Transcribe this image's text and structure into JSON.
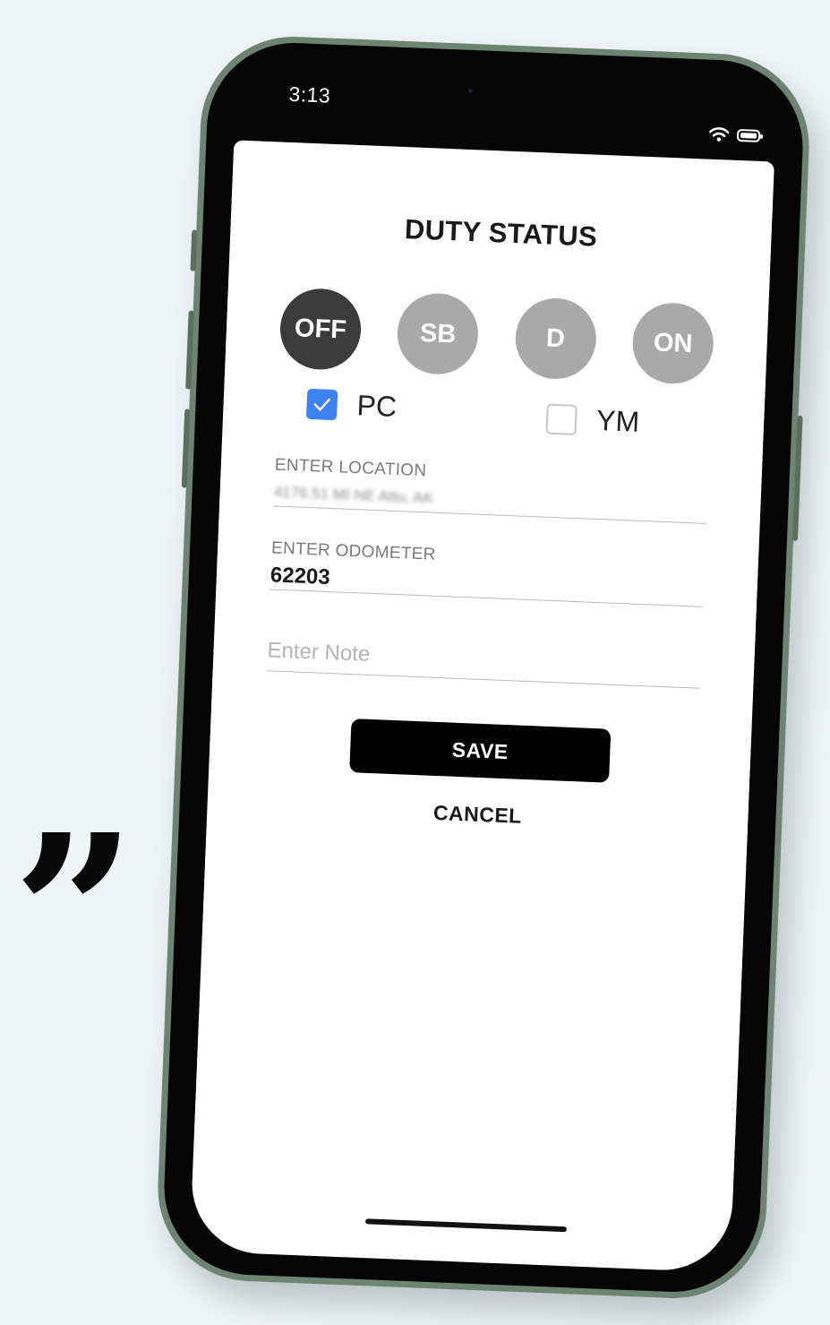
{
  "status_bar": {
    "time": "3:13",
    "wifi_icon": "wifi-icon",
    "battery_icon": "battery-icon"
  },
  "screen": {
    "title": "DUTY STATUS",
    "duty_statuses": [
      {
        "label": "OFF",
        "selected": true
      },
      {
        "label": "SB",
        "selected": false
      },
      {
        "label": "D",
        "selected": false
      },
      {
        "label": "ON",
        "selected": false
      }
    ],
    "checkboxes": {
      "pc": {
        "label": "PC",
        "checked": true
      },
      "ym": {
        "label": "YM",
        "checked": false
      }
    },
    "location": {
      "label": "ENTER LOCATION",
      "value": "4176.51 MI NE Attu, AK"
    },
    "odometer": {
      "label": "ENTER ODOMETER",
      "value": "62203"
    },
    "note": {
      "placeholder": "Enter Note",
      "value": ""
    },
    "save_label": "SAVE",
    "cancel_label": "CANCEL"
  },
  "decor": {
    "quote_mark": "”"
  },
  "colors": {
    "background": "#eff4f7",
    "phone_frame": "#6e8472",
    "selected_status": "#3b3b3b",
    "unselected_status": "#a9a9a9",
    "checkbox_checked": "#3d82f0",
    "save_button": "#000000"
  }
}
